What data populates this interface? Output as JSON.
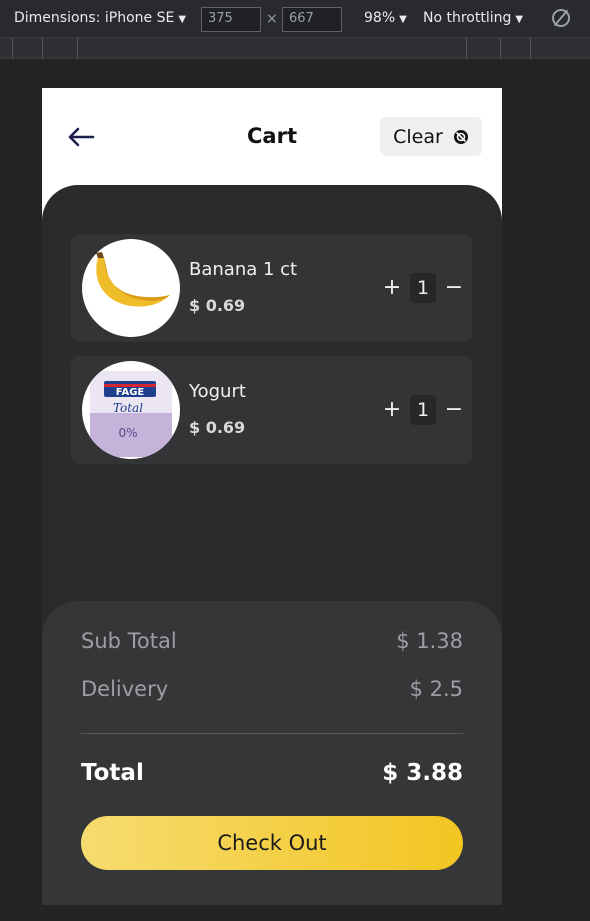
{
  "devtools": {
    "dimensions_label": "Dimensions: iPhone SE",
    "width_value": "375",
    "height_value": "667",
    "times": "×",
    "zoom": "98%",
    "throttling": "No throttling",
    "caret": "▼"
  },
  "header": {
    "title": "Cart",
    "clear_label": "Clear"
  },
  "items": [
    {
      "name": "Banana 1 ct",
      "price": "$ 0.69",
      "quantity": "1",
      "plus": "+",
      "minus": "−"
    },
    {
      "name": "Yogurt",
      "price": "$ 0.69",
      "quantity": "1",
      "plus": "+",
      "minus": "−"
    }
  ],
  "product_image_text": {
    "brand": "FAGE",
    "line": "Total",
    "fat": "0%"
  },
  "summary": {
    "subtotal_label": "Sub Total",
    "subtotal_value": "$ 1.38",
    "delivery_label": "Delivery",
    "delivery_value": "$ 2.5",
    "total_label": "Total",
    "total_value": "$ 3.88",
    "checkout_label": "Check Out"
  },
  "colors": {
    "accent": "#f3c522",
    "panel": "#2a2b2d",
    "card": "#333436"
  }
}
